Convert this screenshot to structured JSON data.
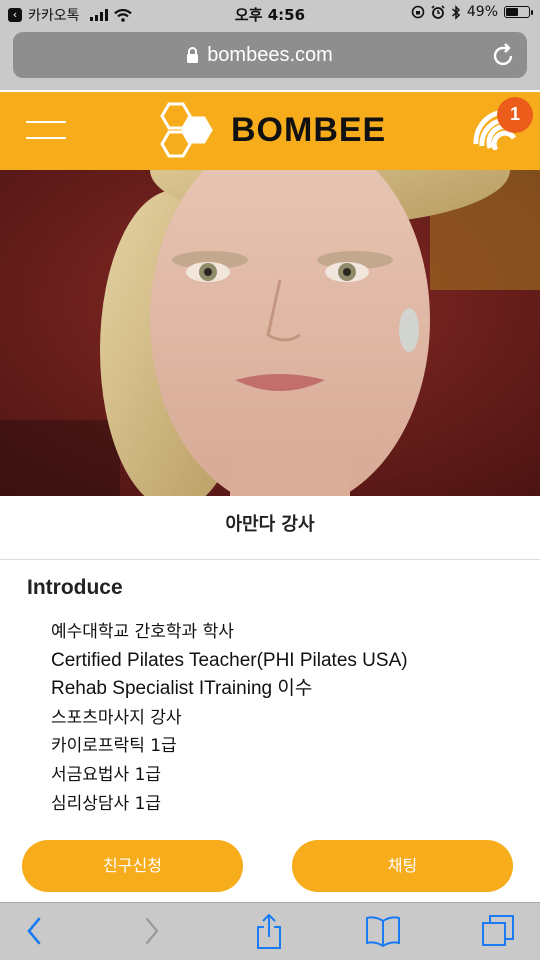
{
  "status_bar": {
    "back_app": "카카오톡",
    "time": "오후 4:56",
    "battery_text": "49%",
    "battery_level": 0.49
  },
  "browser": {
    "domain": "bombees.com"
  },
  "site_header": {
    "brand": "BOMBEE",
    "notification_count": "1",
    "brand_color": "#f7ac1b",
    "badge_color": "#ec5d1b"
  },
  "profile": {
    "name": "아만다 강사",
    "section_title": "Introduce",
    "intro_items": [
      "예수대학교 간호학과 학사",
      "Certified Pilates Teacher(PHI Pilates USA)",
      "Rehab Specialist ITraining 이수",
      "스포츠마사지 강사",
      "카이로프락틱 1급",
      "서금요법사 1급",
      "심리상담사 1급"
    ]
  },
  "actions": {
    "friend_request": "친구신청",
    "chat": "채팅"
  },
  "icons": {
    "back": "chevron-left-icon",
    "forward": "chevron-right-icon",
    "share": "share-icon",
    "bookmarks": "book-icon",
    "tabs": "tabs-icon",
    "menu": "hamburger-icon",
    "notification": "broadcast-icon",
    "lock": "lock-icon",
    "reload": "reload-icon",
    "logo": "honeycomb-icon"
  }
}
